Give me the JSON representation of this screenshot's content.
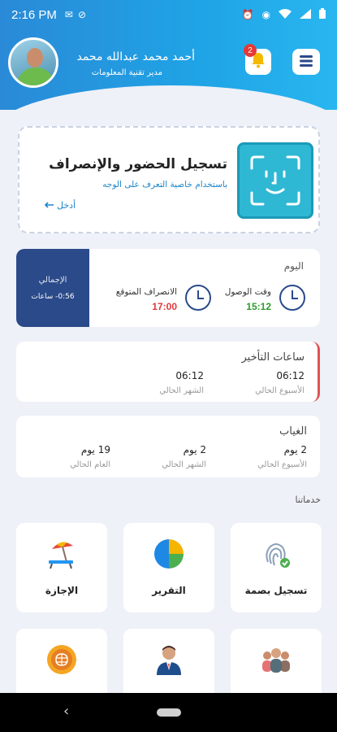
{
  "status_bar": {
    "time": "2:16 PM"
  },
  "header": {
    "user_name": "أحمد محمد عبدالله  محمد",
    "user_role": "مدير تقنية المعلومات",
    "notification_count": "2"
  },
  "face_card": {
    "title": "تسجيل الحضور والإنصراف",
    "subtitle": "باستخدام خاصية التعرف على الوجه",
    "enter_label": "أدخل"
  },
  "today": {
    "title": "اليوم",
    "arrival_label": "وقت الوصول",
    "arrival_time": "15:12",
    "expected_leave_label": "الانصراف المتوقع",
    "expected_leave_time": "17:00",
    "total_label": "الإجمالي",
    "total_value": "0:56- ساعات"
  },
  "late_hours": {
    "title": "ساعات التأخير",
    "week_value": "06:12",
    "week_label": "الأسبوع الحالي",
    "month_value": "06:12",
    "month_label": "الشهر الحالي"
  },
  "absence": {
    "title": "الغياب",
    "week_value": "2 يوم",
    "week_label": "الأسبوع الحالي",
    "month_value": "2 يوم",
    "month_label": "الشهر الحالي",
    "year_value": "19 يوم",
    "year_label": "العام الحالي"
  },
  "services": {
    "title": "خدماتنا",
    "items": [
      {
        "label": "تسجيل بصمة",
        "icon": "fingerprint-icon"
      },
      {
        "label": "التقرير",
        "icon": "pie-chart-icon"
      },
      {
        "label": "الإجازة",
        "icon": "beach-umbrella-icon"
      },
      {
        "label": "",
        "icon": "team-icon"
      },
      {
        "label": "",
        "icon": "manager-icon"
      },
      {
        "label": "",
        "icon": "brain-icon"
      }
    ]
  },
  "colors": {
    "header_blue": "#2a8ad7",
    "navy": "#2b4a8a",
    "arrival_green": "#2e9b2e",
    "leave_red": "#e03a3a",
    "accent": "#1f86c8",
    "late_border": "#e05252"
  }
}
